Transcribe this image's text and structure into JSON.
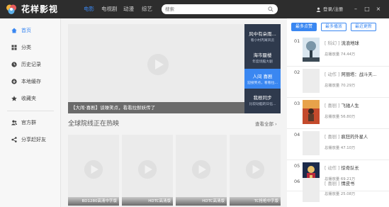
{
  "app": {
    "title": "花样影视"
  },
  "nav": {
    "items": [
      {
        "label": "电影"
      },
      {
        "label": "电视剧"
      },
      {
        "label": "动漫"
      },
      {
        "label": "综艺"
      }
    ],
    "active_index": 0
  },
  "search": {
    "placeholder": "搜索"
  },
  "account": {
    "login_label": "登录/注册"
  },
  "sidebar": {
    "items": [
      {
        "label": "首页",
        "icon": "home-icon"
      },
      {
        "label": "分类",
        "icon": "grid-icon"
      },
      {
        "label": "历史记录",
        "icon": "clock-icon"
      },
      {
        "label": "本地缓存",
        "icon": "download-icon"
      },
      {
        "label": "收藏夹",
        "icon": "star-icon"
      },
      {
        "label": "官方群",
        "icon": "group-icon"
      },
      {
        "label": "分享赶好友",
        "icon": "share-icon"
      }
    ],
    "active_index": 0
  },
  "banner": {
    "caption": "【大闹·喜剧】谈噪笑点，看看拉鲜妖传了",
    "side_items": [
      {
        "title": "风中有朵雨...",
        "subtitle": "看小村丙寓风云"
      },
      {
        "title": "海市蜃楼",
        "subtitle": "年度烧脑大剧"
      },
      {
        "title": "人间 喜剧",
        "subtitle": "迎接笑点，看看拉..."
      },
      {
        "title": "我根同步",
        "subtitle": "比较动脑的日伍..."
      }
    ],
    "active_index": 2
  },
  "section": {
    "title": "全球院线正在热映",
    "more_label": "查看全部 ›",
    "cards": [
      {
        "label": "BD1280高清中字版"
      },
      {
        "label": "HDTC高清版"
      },
      {
        "label": "HDTC高清版"
      },
      {
        "label": "TC抢枪中字版"
      }
    ]
  },
  "ranking": {
    "tabs": [
      {
        "label": "最多点赞"
      },
      {
        "label": "最多播放"
      },
      {
        "label": "最近更新"
      }
    ],
    "active_tab": 0,
    "items": [
      {
        "rank": "01",
        "tag": "[ 科幻 ]",
        "name": "流浪地球",
        "views": "总播放量 74.44万"
      },
      {
        "rank": "02",
        "tag": "[ 动作 ]",
        "name": "阿丽塔：战斗天...",
        "views": "总播放量 70.29万"
      },
      {
        "rank": "03",
        "tag": "[ 喜剧 ]",
        "name": "飞驰人生",
        "views": "总播放量 56.80万"
      },
      {
        "rank": "04",
        "tag": "[ 喜剧 ]",
        "name": "疯狂的外星人",
        "views": "总播放量 47.10万"
      },
      {
        "rank": "05",
        "tag": "[ 动作 ]",
        "name": "惊奇队长",
        "views": "总播放量 69.21万"
      },
      {
        "rank": "06",
        "tag": "[ 喜剧 ]",
        "name": "情皮书",
        "views": "总播放量 25.08万"
      }
    ]
  },
  "colors": {
    "accent": "#3a87f1",
    "topbar": "#2d2d2d",
    "banner_side": "#2f3a4d"
  }
}
